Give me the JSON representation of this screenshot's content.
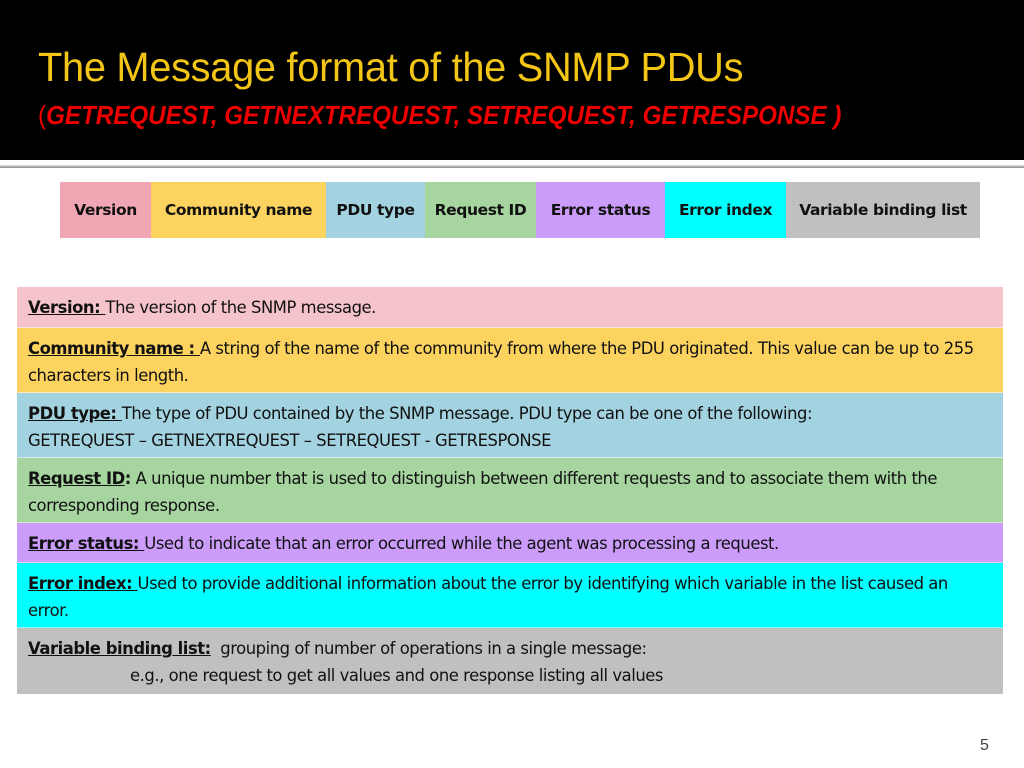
{
  "slide": {
    "title": "The Message format of the SNMP PDUs",
    "subtitle_open": "(",
    "subtitle_items": "GETREQUEST, GETNEXTREQUEST, SETREQUEST, GETRESPONSE )",
    "page_number": "5",
    "colors": {
      "header_bg": "#000000",
      "title": "#f3c516",
      "subtitle": "#ee0000"
    }
  },
  "pdu_fields": [
    {
      "label": "Version",
      "color": "#f0a7b3"
    },
    {
      "label": "Community name",
      "color": "#fdd360"
    },
    {
      "label": "PDU type",
      "color": "#a3d3e0"
    },
    {
      "label": "Request ID",
      "color": "#a6d5a0"
    },
    {
      "label": "Error status",
      "color": "#cb9cf9"
    },
    {
      "label": "Error index",
      "color": "#00ffff"
    },
    {
      "label": "Variable binding list",
      "color": "#c0c0c0"
    }
  ],
  "descriptions": [
    {
      "term": "Version: ",
      "colon": "",
      "text": "The version of the SNMP message.",
      "text2": "",
      "color": "#f5c4cb"
    },
    {
      "term": "Community name : ",
      "colon": "",
      "text": "A string of the name of the community from where the PDU originated. This value can be up to 255 characters in length.",
      "text2": "",
      "color": "#fdd360"
    },
    {
      "term": "PDU type: ",
      "colon": "",
      "text": "The type of PDU contained by the SNMP message. PDU type can be one of the following:",
      "text2": "GETREQUEST – GETNEXTREQUEST – SETREQUEST - GETRESPONSE",
      "color": "#a3d3e0"
    },
    {
      "term": "Request ID",
      "colon": ":",
      "text": " A unique number that is used to distinguish between different requests and to associate them with the corresponding response.",
      "text2": "",
      "color": "#a6d5a0"
    },
    {
      "term": "Error status: ",
      "colon": "",
      "text": "Used to indicate that an error occurred while the agent was processing a request.",
      "text2": "",
      "color": "#cb9cf9"
    },
    {
      "term": "Error index: ",
      "colon": "",
      "text": "Used to provide additional information about the error by identifying which variable in the list caused an error.",
      "text2": "",
      "color": "#00ffff"
    },
    {
      "term": "Variable binding list:",
      "colon": "",
      "text": "  grouping of number of operations in a single message:",
      "text2": "e.g., one request to get all values and one response listing all values",
      "color": "#c0c0c0"
    }
  ]
}
